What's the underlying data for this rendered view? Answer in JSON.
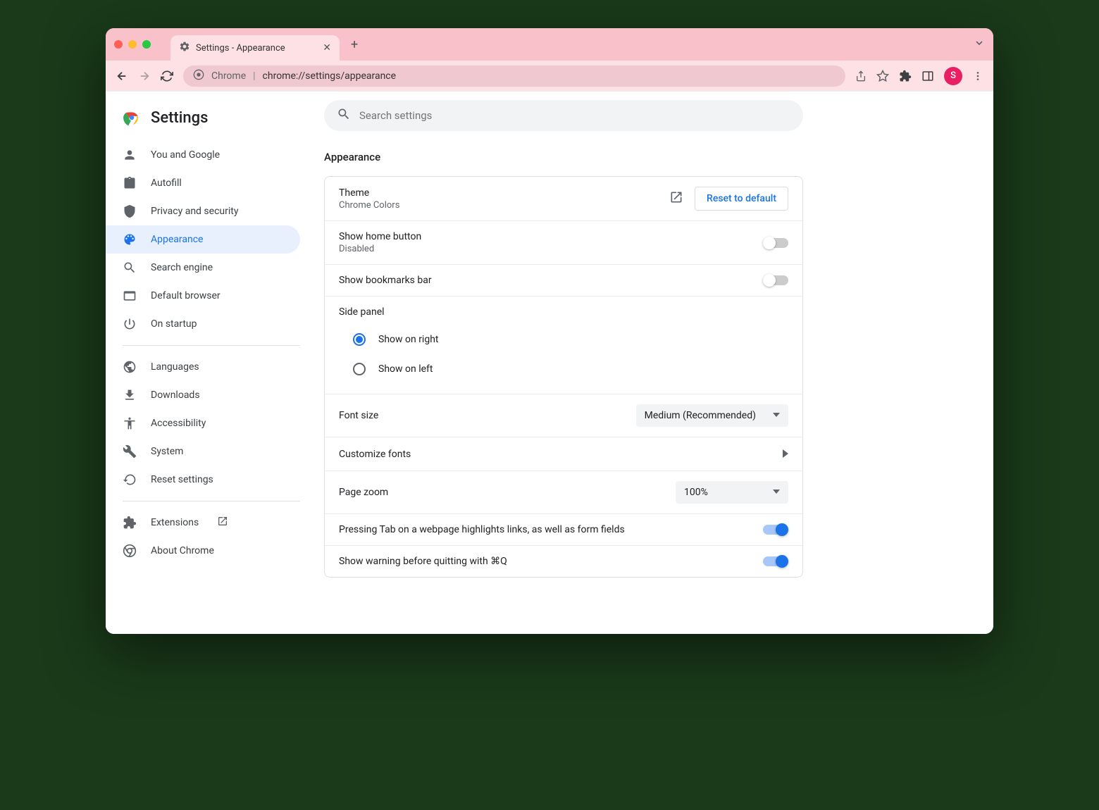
{
  "tab": {
    "title": "Settings - Appearance"
  },
  "address": {
    "prefix": "Chrome",
    "url": "chrome://settings/appearance"
  },
  "avatar": {
    "initial": "S"
  },
  "sidebar": {
    "title": "Settings",
    "items": [
      {
        "label": "You and Google"
      },
      {
        "label": "Autofill"
      },
      {
        "label": "Privacy and security"
      },
      {
        "label": "Appearance"
      },
      {
        "label": "Search engine"
      },
      {
        "label": "Default browser"
      },
      {
        "label": "On startup"
      }
    ],
    "items2": [
      {
        "label": "Languages"
      },
      {
        "label": "Downloads"
      },
      {
        "label": "Accessibility"
      },
      {
        "label": "System"
      },
      {
        "label": "Reset settings"
      }
    ],
    "items3": [
      {
        "label": "Extensions"
      },
      {
        "label": "About Chrome"
      }
    ]
  },
  "search": {
    "placeholder": "Search settings"
  },
  "section": {
    "title": "Appearance"
  },
  "theme": {
    "label": "Theme",
    "value": "Chrome Colors",
    "reset": "Reset to default"
  },
  "homeButton": {
    "label": "Show home button",
    "value": "Disabled"
  },
  "bookmarks": {
    "label": "Show bookmarks bar"
  },
  "sidePanel": {
    "label": "Side panel",
    "right": "Show on right",
    "left": "Show on left"
  },
  "fontSize": {
    "label": "Font size",
    "value": "Medium (Recommended)"
  },
  "customizeFonts": {
    "label": "Customize fonts"
  },
  "pageZoom": {
    "label": "Page zoom",
    "value": "100%"
  },
  "tabHighlight": {
    "label": "Pressing Tab on a webpage highlights links, as well as form fields"
  },
  "quitWarning": {
    "label": "Show warning before quitting with ⌘Q"
  }
}
